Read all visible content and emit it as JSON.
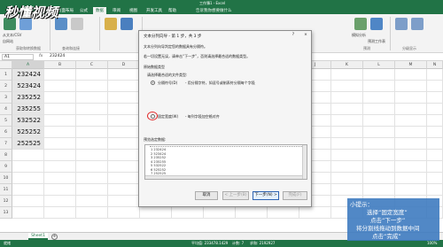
{
  "window": {
    "title": "工作簿1 - Excel"
  },
  "tabs": [
    "文件",
    "开始",
    "插入",
    "页面布局",
    "公式",
    "数据",
    "审阅",
    "视图",
    "开发工具",
    "帮助"
  ],
  "active_tab": "数据",
  "search_hint": "告诉我你想要做什么",
  "ribbon": {
    "from_text_csv": "从文本/CSV",
    "from_web": "自网站",
    "get_external_data_group": "获取和转换数据",
    "query_group": "查询和连接",
    "what_if": "模拟分析",
    "forecast_sheet": "预测工作表",
    "forecast_group": "预测",
    "outline_group": "分级显示"
  },
  "formula_bar": {
    "name_box": "A1",
    "fx": "fx",
    "value": "232424"
  },
  "grid": {
    "columns": [
      "A",
      "B",
      "C",
      "D",
      "E",
      "F",
      "G",
      "H",
      "I",
      "J",
      "K",
      "L",
      "M",
      "N"
    ],
    "selected_column": "A",
    "row_numbers": [
      "1",
      "2",
      "3",
      "4",
      "5",
      "6",
      "7",
      "8",
      "9",
      "10",
      "11",
      "12",
      "13"
    ],
    "column_a_values": [
      "232424",
      "523424",
      "235252",
      "235255",
      "532522",
      "525252",
      "252525"
    ]
  },
  "sheet": {
    "tab": "Sheet1",
    "add": "+"
  },
  "status": {
    "ready": "就绪",
    "average": "平均值: 233478.1429",
    "count": "计数: 7",
    "sum": "求和: 2192927",
    "zoom": "100%"
  },
  "watermark": "秒懂视频",
  "dialog": {
    "title": "文本分列向导 - 第 1 步，共 3 步",
    "help": "?",
    "close": "×",
    "intro1": "文本分列向导判定您的数据具有分隔符。",
    "intro2": "若一切设置无误，请单击“下一步”，否则请选择最合适的数据类型。",
    "original_type_label": "原始数据类型",
    "choose_prompt": "请选择最合适的文件类型:",
    "option_delimited": "分隔符号(D)",
    "option_delimited_desc": "- 用分隔字符，如逗号或制表符分隔每个字段",
    "option_fixed": "固定宽度(W)",
    "option_fixed_desc": "- 每列字段加空格对齐",
    "preview_label": "预览选定数据:",
    "preview_lines": [
      "1 232424",
      "2 523424",
      "3 235252",
      "4 235255",
      "5 532522",
      "6 525252",
      "7 252525"
    ],
    "cancel": "取消",
    "back": "< 上一步(B)",
    "next": "下一步(N) >",
    "finish": "完成(F)"
  },
  "tip": {
    "title": "小提示：",
    "lines": [
      "选择“固定宽度”",
      "点击“下一步”",
      "将分割线拖动到数据中间",
      "点击“完成”"
    ]
  },
  "colors": {
    "excel_green": "#217346",
    "tip_blue": "#3977be",
    "highlight_red": "#e32b2b"
  }
}
